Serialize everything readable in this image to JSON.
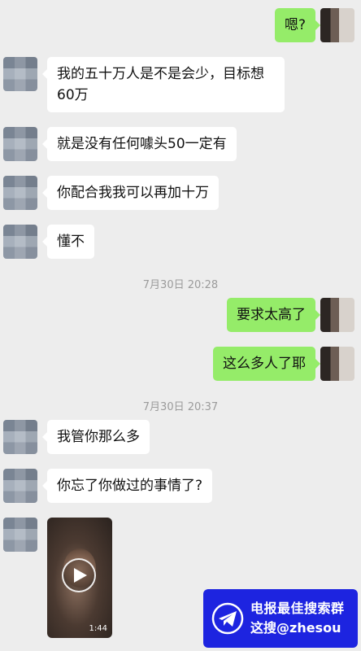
{
  "messages": [
    {
      "side": "right",
      "text": "嗯?"
    },
    {
      "side": "left",
      "line1": "我的五十万人是不是会少，目标想",
      "line2": "60万"
    },
    {
      "side": "left",
      "text": "就是没有任何噱头50一定有"
    },
    {
      "side": "left",
      "text": "你配合我我可以再加十万"
    },
    {
      "side": "left",
      "text": "懂不"
    },
    {
      "side": "right",
      "text": "要求太高了"
    },
    {
      "side": "right",
      "text": "这么多人了耶"
    },
    {
      "side": "left",
      "text": "我管你那么多"
    },
    {
      "side": "left",
      "text": "你忘了你做过的事情了?"
    }
  ],
  "timestamps": [
    "7月30日 20:28",
    "7月30日 20:37"
  ],
  "video": {
    "duration": "1:44",
    "icon": "play-icon"
  },
  "watermark": {
    "line1": "电报最佳搜索群",
    "line2": "这搜@zhesou",
    "icon": "telegram-plane-icon"
  },
  "colors": {
    "background": "#ededed",
    "self_bubble": "#95ec69",
    "other_bubble": "#ffffff",
    "watermark": "#1d24e0"
  }
}
